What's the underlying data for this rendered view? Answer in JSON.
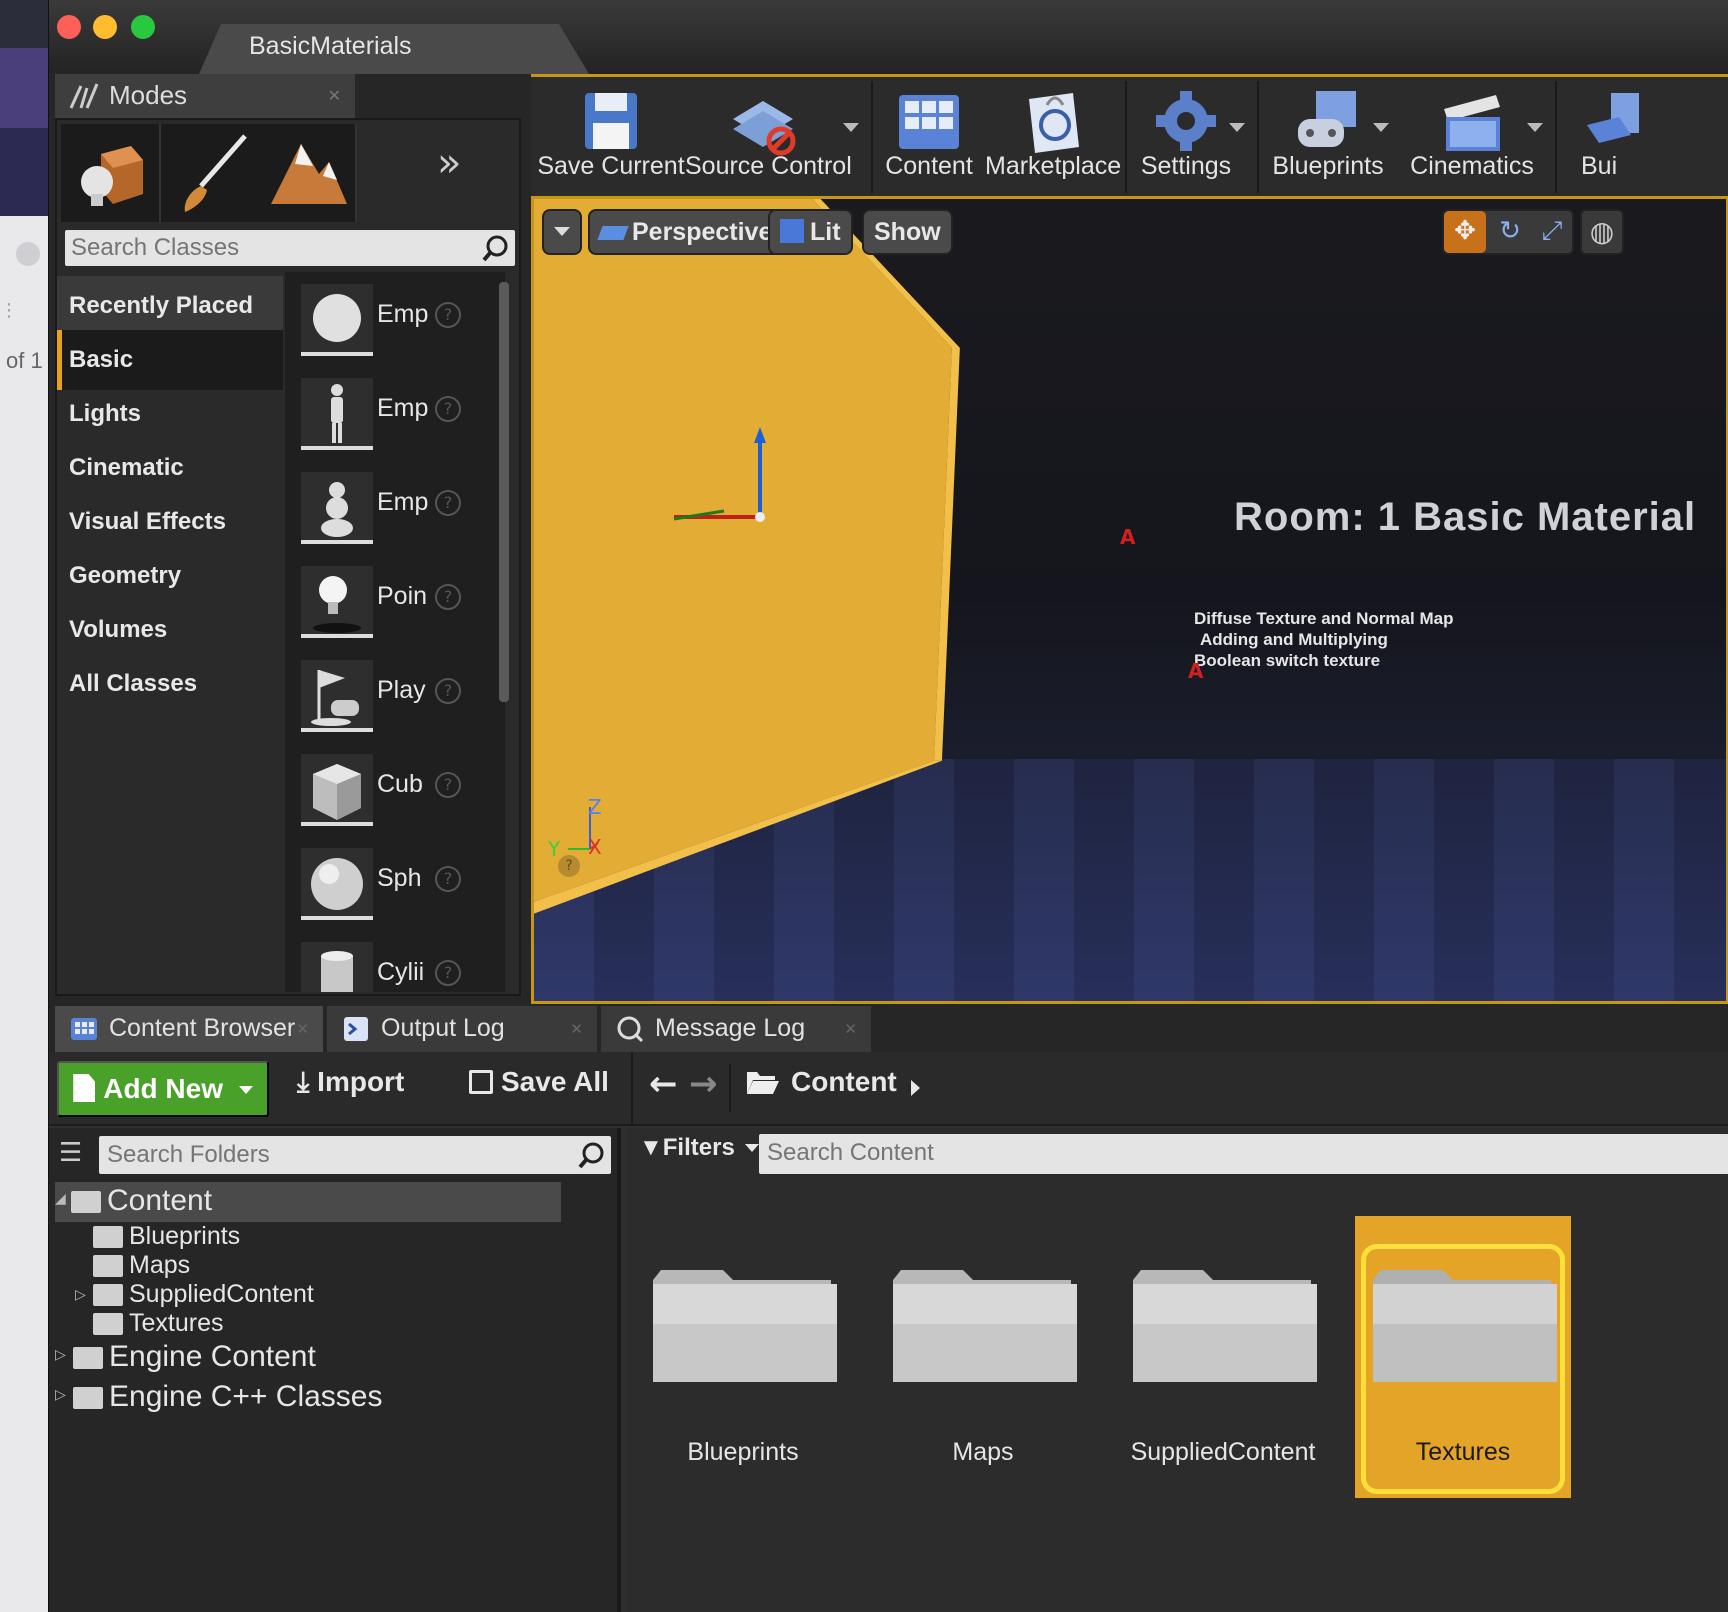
{
  "background_window": {
    "page_text": "of 1"
  },
  "window": {
    "document_tab": "BasicMaterials",
    "colors": {
      "accent": "#e8a21a",
      "add_new": "#4aa12a",
      "selection": "#e3a428",
      "selection_ring": "#ffe03a"
    }
  },
  "modes": {
    "tab_label": "Modes",
    "mode_icons": [
      "place-mode-icon",
      "paint-mode-icon",
      "landscape-mode-icon"
    ],
    "search_placeholder": "Search Classes",
    "categories": [
      "Recently Placed",
      "Basic",
      "Lights",
      "Cinematic",
      "Visual Effects",
      "Geometry",
      "Volumes",
      "All Classes"
    ],
    "selected_category": "Basic",
    "items": [
      {
        "label": "Emp",
        "icon": "empty-actor-icon"
      },
      {
        "label": "Emp",
        "icon": "empty-character-icon"
      },
      {
        "label": "Emp",
        "icon": "empty-pawn-icon"
      },
      {
        "label": "Poin",
        "icon": "point-light-icon"
      },
      {
        "label": "Play",
        "icon": "player-start-icon"
      },
      {
        "label": "Cub",
        "icon": "cube-icon"
      },
      {
        "label": "Sph",
        "icon": "sphere-icon"
      },
      {
        "label": "Cylii",
        "icon": "cylinder-icon"
      }
    ]
  },
  "toolbar": {
    "buttons": [
      {
        "label": "Save Current",
        "icon": "save-icon"
      },
      {
        "label": "Source Control",
        "icon": "source-control-icon"
      },
      {
        "label": "Content",
        "icon": "content-icon"
      },
      {
        "label": "Marketplace",
        "icon": "marketplace-icon"
      },
      {
        "label": "Settings",
        "icon": "settings-icon"
      },
      {
        "label": "Blueprints",
        "icon": "blueprints-icon"
      },
      {
        "label": "Cinematics",
        "icon": "cinematics-icon"
      },
      {
        "label": "Bui",
        "icon": "build-icon"
      }
    ]
  },
  "viewport": {
    "perspective_label": "Perspective",
    "lit_label": "Lit",
    "show_label": "Show",
    "room_title": "Room:  1 Basic Material",
    "room_lines": [
      "Diffuse Texture and Normal Map",
      "Adding and Multiplying",
      "Boolean switch texture"
    ],
    "axis": {
      "z": "Z",
      "x": "X",
      "y": "Y"
    }
  },
  "bottom_tabs": [
    {
      "label": "Content Browser",
      "icon": "content-browser-icon"
    },
    {
      "label": "Output Log",
      "icon": "output-log-icon"
    },
    {
      "label": "Message Log",
      "icon": "message-log-icon"
    }
  ],
  "content_browser": {
    "add_new": "Add New",
    "import": "Import",
    "save_all": "Save All",
    "path": "Content",
    "search_folders_placeholder": "Search Folders",
    "filters": "Filters",
    "search_content_placeholder": "Search Content",
    "tree": [
      {
        "label": "Content",
        "level": 0,
        "expanded": true
      },
      {
        "label": "Blueprints",
        "level": 1
      },
      {
        "label": "Maps",
        "level": 1
      },
      {
        "label": "SuppliedContent",
        "level": 1,
        "has_children": true
      },
      {
        "label": "Textures",
        "level": 1
      },
      {
        "label": "Engine Content",
        "level": 0
      },
      {
        "label": "Engine C++ Classes",
        "level": 0
      }
    ],
    "assets": [
      "Blueprints",
      "Maps",
      "SuppliedContent",
      "Textures"
    ],
    "selected_asset": "Textures"
  }
}
